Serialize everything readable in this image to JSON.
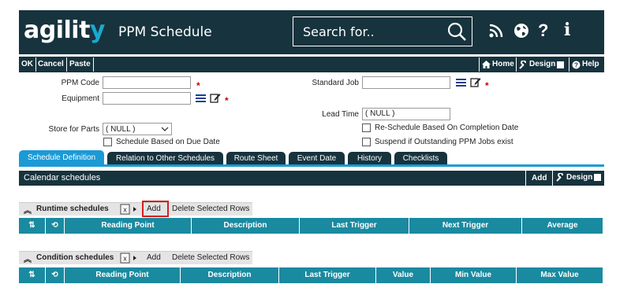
{
  "header": {
    "logo_main": "agilit",
    "logo_accent": "y",
    "title": "PPM Schedule",
    "search_placeholder": "Search for.."
  },
  "toolbar": {
    "ok": "OK",
    "cancel": "Cancel",
    "paste": "Paste",
    "home": "Home",
    "design": "Design",
    "help": "Help"
  },
  "form": {
    "ppm_code_label": "PPM Code",
    "equipment_label": "Equipment",
    "store_label": "Store for Parts",
    "store_value": "( NULL )",
    "due_date_label": "Schedule Based on Due Date",
    "standard_job_label": "Standard Job",
    "lead_time_label": "Lead Time",
    "lead_time_value": "( NULL )",
    "reschedule_label": "Re-Schedule Based On Completion Date",
    "suspend_label": "Suspend if Outstanding PPM Jobs exist"
  },
  "tabs": [
    "Schedule Definition",
    "Relation to Other Schedules",
    "Route Sheet",
    "Event Date",
    "History",
    "Checklists"
  ],
  "calendar": {
    "title": "Calendar schedules",
    "add": "Add",
    "design": "Design"
  },
  "runtime": {
    "title": "Runtime schedules",
    "add": "Add",
    "delete": "Delete Selected Rows",
    "columns": [
      "Reading Point",
      "Description",
      "Last Trigger",
      "Next Trigger",
      "Average"
    ]
  },
  "condition": {
    "title": "Condition schedules",
    "add": "Add",
    "delete": "Delete Selected Rows",
    "columns": [
      "Reading Point",
      "Description",
      "Last Trigger",
      "Value",
      "Min Value",
      "Max Value"
    ]
  },
  "colors": {
    "header_bg": "#17333d",
    "accent": "#1b9ad6",
    "grid_header": "#1a8aa0",
    "required": "#cc0000",
    "highlight": "#d21f1f"
  },
  "icons": [
    "search-icon",
    "rss-icon",
    "globe-icon",
    "help-icon",
    "info-icon",
    "home-icon",
    "wrench-icon",
    "list-icon",
    "edit-icon",
    "excel-icon",
    "sort-icon",
    "refresh-icon",
    "chevron-up-icon"
  ]
}
